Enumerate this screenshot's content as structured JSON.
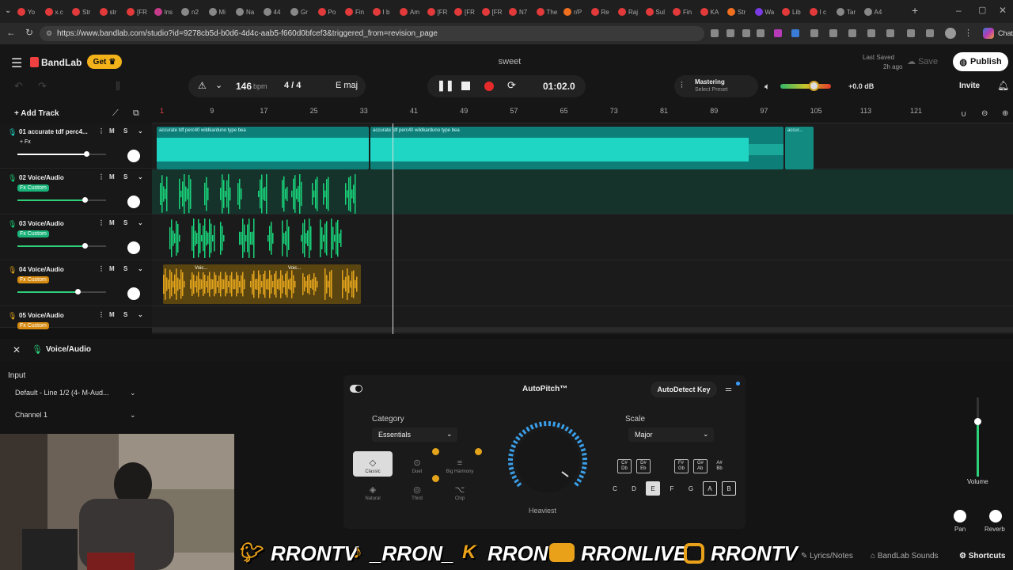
{
  "browser": {
    "tabs": [
      "Yo",
      "x.c",
      "Str",
      "str",
      "[FR",
      "Ins",
      "n2",
      "Mi",
      "Na",
      "44",
      "Gr",
      "Po",
      "Fin",
      "I b",
      "Am",
      "[FR",
      "[FR",
      "[FR",
      "N7",
      "The",
      "r/P",
      "Re",
      "Raj",
      "Sul",
      "Fin",
      "KA",
      "Str",
      "Wa",
      "Lib",
      "I c",
      "Tar",
      "A4"
    ],
    "url": "https://www.bandlab.com/studio?id=9278cb5d-b0d6-4d4c-aab5-f660d0bfcef3&triggered_from=revision_page",
    "chat_label": "Chat"
  },
  "app": {
    "brand": "BandLab",
    "get_label": "Get",
    "project_title": "sweet",
    "last_saved_label": "Last Saved",
    "last_saved_time": "2h ago",
    "save_label": "Save",
    "publish_label": "Publish",
    "invite_label": "Invite",
    "bpm_value": "146",
    "bpm_unit": "bpm",
    "time_sig": "4 / 4",
    "key": "E maj",
    "time_display": "01:02.0",
    "mastering_label": "Mastering",
    "mastering_preset": "Select Preset",
    "master_gain": "+0.0 dB",
    "add_track_label": "Add Track"
  },
  "ruler": [
    "1",
    "9",
    "17",
    "25",
    "33",
    "41",
    "49",
    "57",
    "65",
    "73",
    "81",
    "89",
    "97",
    "105",
    "113",
    "121"
  ],
  "tracks": [
    {
      "name": "01  accurate tdf perc4...",
      "badge": "+ Fx",
      "badge_color": "#181818",
      "color": "#1fd6c4",
      "vol": 0.78
    },
    {
      "name": "02  Voice/Audio",
      "badge": "Fx Custom",
      "badge_color": "#19b37a",
      "color": "#19d37a",
      "vol": 0.76
    },
    {
      "name": "03  Voice/Audio",
      "badge": "Fx Custom",
      "badge_color": "#19b37a",
      "color": "#19d37a",
      "vol": 0.76
    },
    {
      "name": "04  Voice/Audio",
      "badge": "Fx Custom",
      "badge_color": "#d68a10",
      "color": "#e3a41c",
      "vol": 0.68
    },
    {
      "name": "05  Voice/Audio",
      "badge": "Fx Custom",
      "badge_color": "#d68a10",
      "color": "#e3a41c",
      "vol": 0.7
    }
  ],
  "clips": {
    "track1_label_a": "accurate tdf perc40 wildkarduno type bea",
    "track1_label_b": "accurate tdf perc40 wildkarduno type bea",
    "track1_label_c": "accur...",
    "track4_label_a": "Voic...",
    "track4_label_b": "Voic..."
  },
  "panel": {
    "track_title": "Voice/Audio",
    "input_label": "Input",
    "input_value": "Default - Line 1/2 (4- M-Aud...",
    "channel_value": "Channel 1",
    "volume_label": "Volume",
    "pan_label": "Pan",
    "reverb_label": "Reverb"
  },
  "autopitch": {
    "title": "AutoPitch™",
    "detect_label": "AutoDetect Key",
    "category_label": "Category",
    "category_value": "Essentials",
    "scale_label": "Scale",
    "scale_value": "Major",
    "knob_label": "Heaviest",
    "effects": [
      "Classic",
      "Duet",
      "Big Harmony",
      "Natural",
      "Third",
      "Chip"
    ],
    "sharps": [
      "C#\nDb",
      "D#\nEb",
      "F#\nGb",
      "G#\nAb",
      "A#\nBb"
    ],
    "naturals": [
      "C",
      "D",
      "E",
      "F",
      "G",
      "A",
      "B"
    ],
    "active_naturals": [
      "E",
      "A",
      "B"
    ]
  },
  "social": [
    "RRONTV",
    "_RRON_",
    "RRON",
    "RRONLIVE",
    "RRONTV"
  ],
  "footer": {
    "lyrics": "Lyrics/Notes",
    "sounds": "BandLab Sounds",
    "shortcuts": "Shortcuts"
  }
}
